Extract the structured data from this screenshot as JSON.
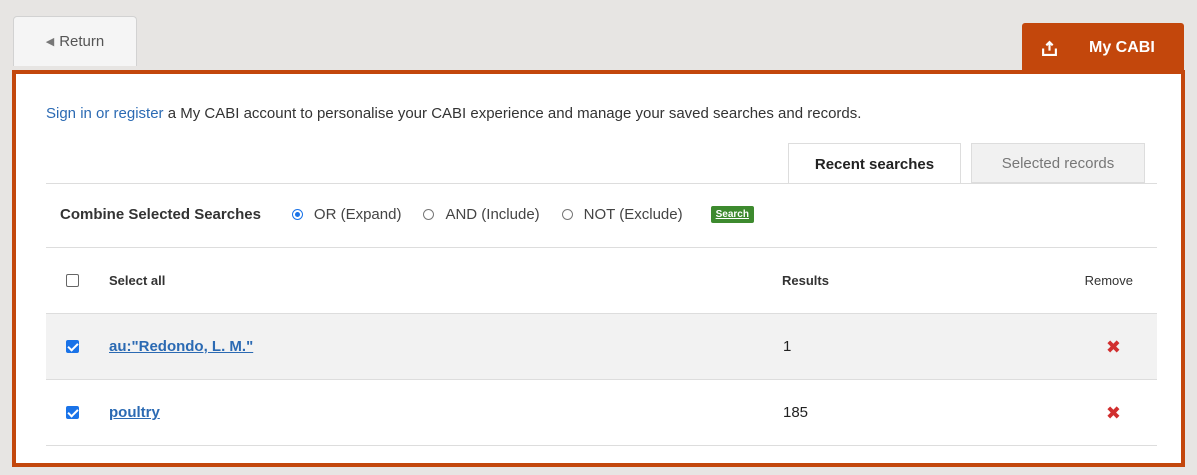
{
  "return_button": {
    "label": "Return",
    "icon": "arrow-left-icon"
  },
  "my_cabi_tab": {
    "label": "My CABI",
    "icon": "export-icon",
    "color": "#c3470c"
  },
  "intro": {
    "link_text": "Sign in or register",
    "text": " a My CABI account to personalise your CABI experience and manage your saved searches and records."
  },
  "tabs": [
    {
      "label": "Recent searches",
      "active": true
    },
    {
      "label": "Selected records",
      "active": false
    }
  ],
  "combine": {
    "label": "Combine Selected Searches",
    "options": [
      {
        "label": "OR (Expand)",
        "selected": true
      },
      {
        "label": "AND (Include)",
        "selected": false
      },
      {
        "label": "NOT (Exclude)",
        "selected": false
      }
    ],
    "search_button": "Search"
  },
  "table": {
    "headers": {
      "select_all": "Select all",
      "results": "Results",
      "remove": "Remove"
    },
    "rows": [
      {
        "query": "au:\"Redondo, L. M.\"",
        "results": "1",
        "checked": true
      },
      {
        "query": "poultry",
        "results": "185",
        "checked": true
      }
    ]
  }
}
